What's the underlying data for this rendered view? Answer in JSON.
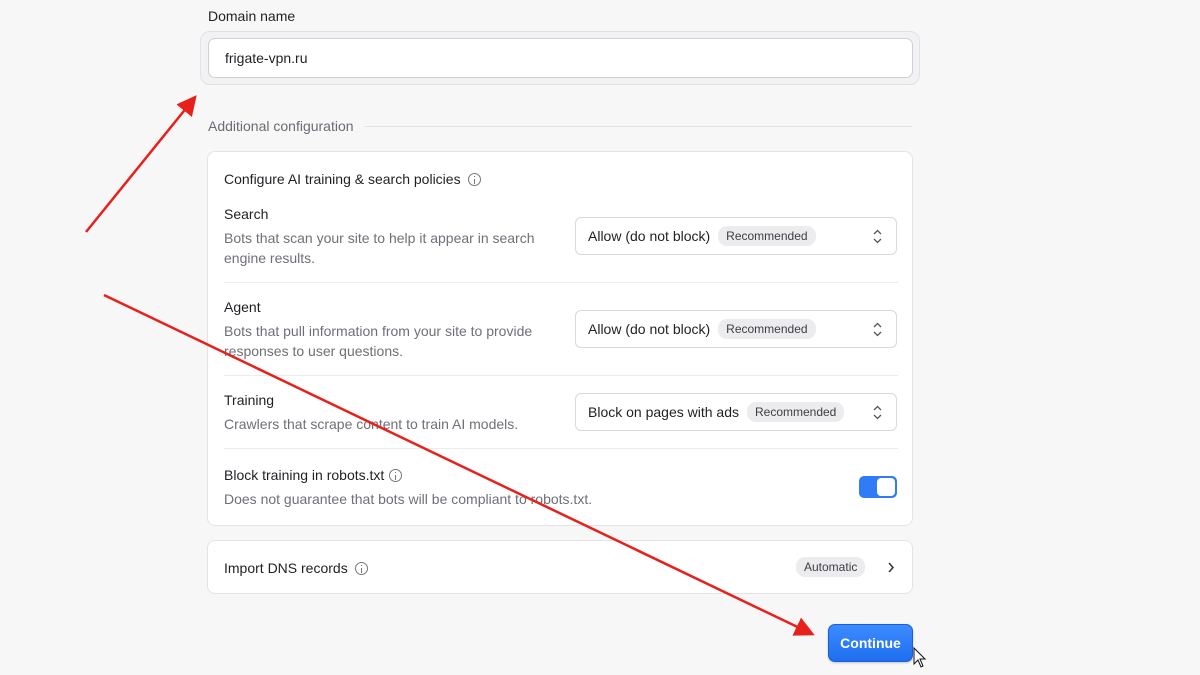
{
  "domain": {
    "label": "Domain name",
    "value": "frigate-vpn.ru"
  },
  "additional": {
    "title": "Additional configuration"
  },
  "ai_policies": {
    "title": "Configure AI training & search policies",
    "items": [
      {
        "title": "Search",
        "description": "Bots that scan your site to help it appear in search engine results.",
        "selected": "Allow (do not block)",
        "badge": "Recommended"
      },
      {
        "title": "Agent",
        "description": "Bots that pull information from your site to provide responses to user questions.",
        "selected": "Allow (do not block)",
        "badge": "Recommended"
      },
      {
        "title": "Training",
        "description": "Crawlers that scrape content to train AI models.",
        "selected": "Block on pages with ads",
        "badge": "Recommended"
      }
    ],
    "robots": {
      "title": "Block training in robots.txt",
      "description": "Does not guarantee that bots will be compliant to robots.txt.",
      "enabled": true
    }
  },
  "dns": {
    "title": "Import DNS records",
    "badge": "Automatic"
  },
  "continue_label": "Continue",
  "colors": {
    "accent": "#2f7cf6",
    "annotation_arrow": "#e8201c"
  },
  "icons": {
    "info": "info-icon",
    "select": "updown-chevron-icon",
    "dns": "chevron-right-icon",
    "cursor": "mouse-pointer-icon"
  }
}
